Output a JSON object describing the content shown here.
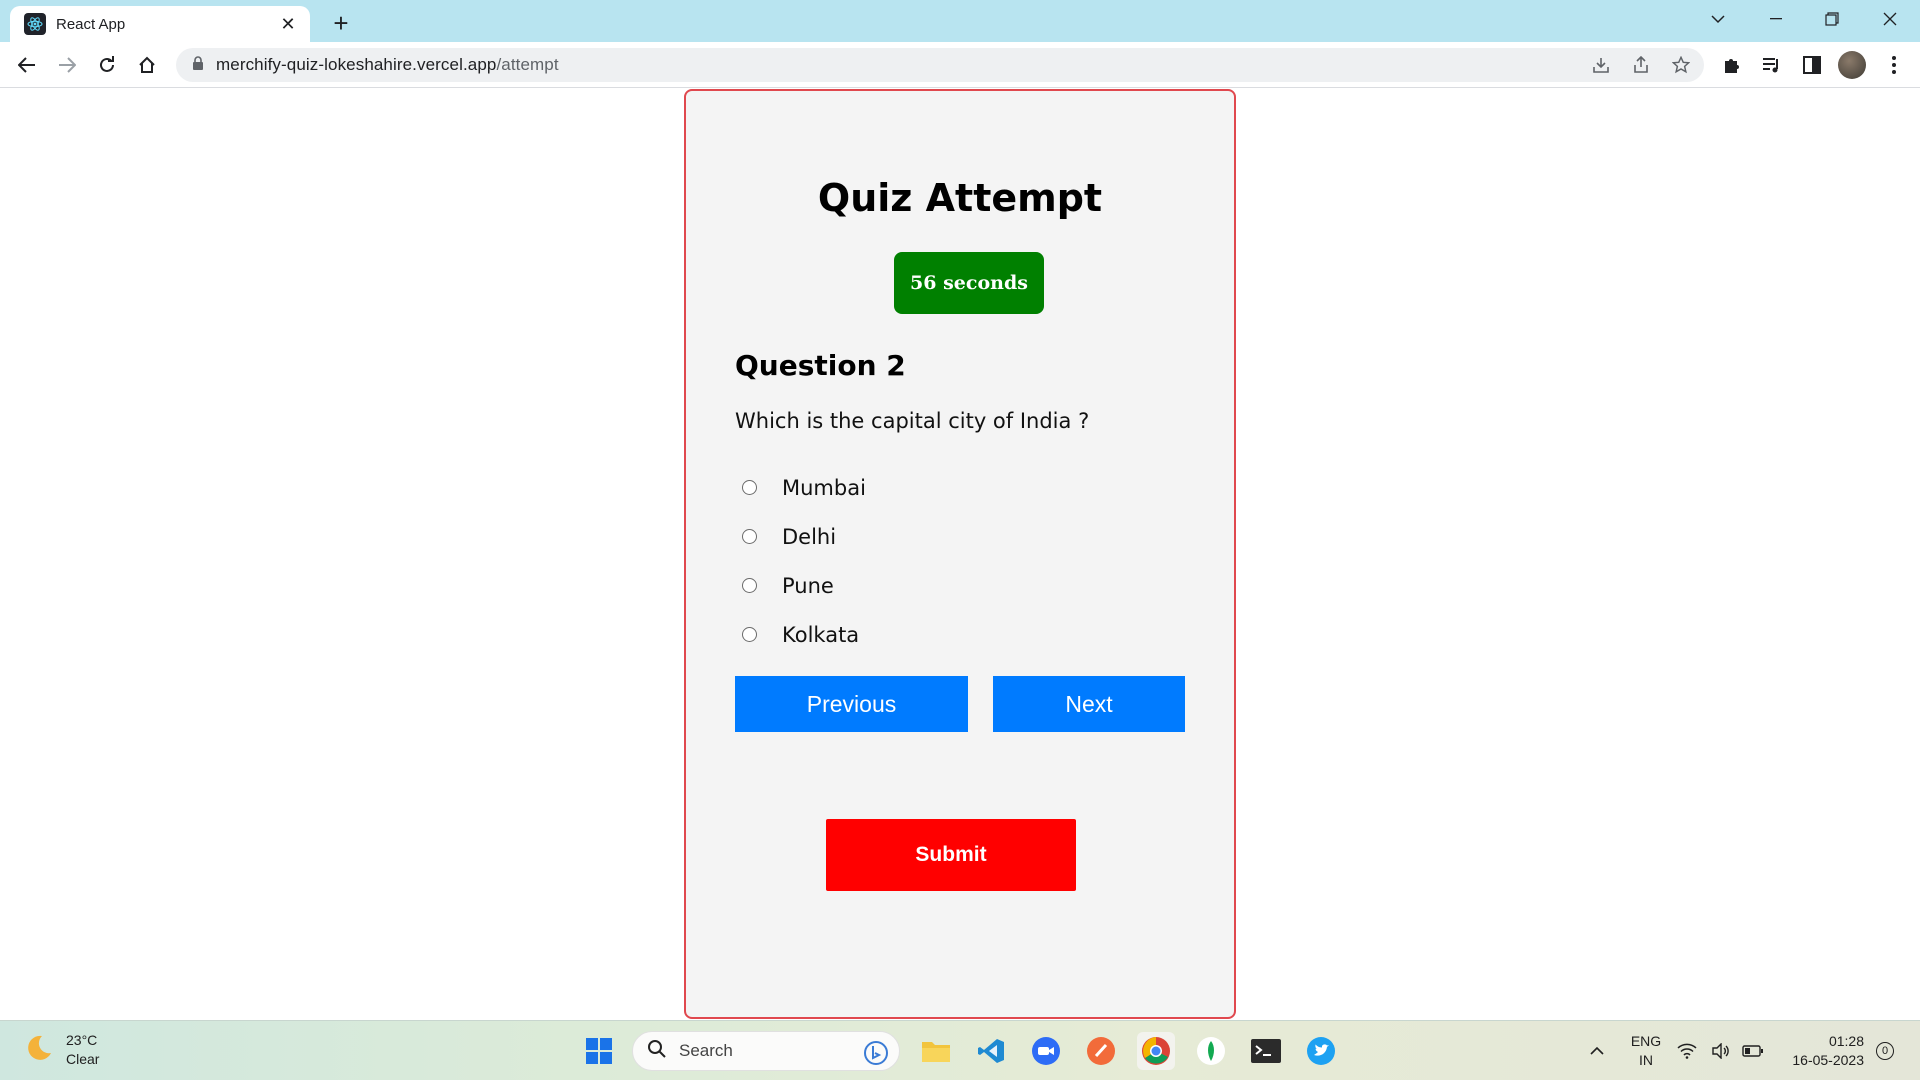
{
  "browser": {
    "tab_title": "React App",
    "url_host": "merchify-quiz-lokeshahire.vercel.app",
    "url_path": "/attempt"
  },
  "quiz": {
    "title": "Quiz Attempt",
    "timer": "56 seconds",
    "question_heading": "Question 2",
    "question_text": "Which is the capital city of India ?",
    "options": [
      "Mumbai",
      "Delhi",
      "Pune",
      "Kolkata"
    ],
    "previous_label": "Previous",
    "next_label": "Next",
    "submit_label": "Submit"
  },
  "taskbar": {
    "temperature": "23°C",
    "weather_condition": "Clear",
    "search_label": "Search",
    "language_line1": "ENG",
    "language_line2": "IN",
    "time": "01:28",
    "date": "16-05-2023",
    "notification_count": "0"
  },
  "colors": {
    "card_border": "#e0484e",
    "timer_bg": "#008000",
    "nav_button_bg": "#007bff",
    "submit_bg": "#ff0000",
    "tabbar_bg": "#b8e4f0"
  }
}
